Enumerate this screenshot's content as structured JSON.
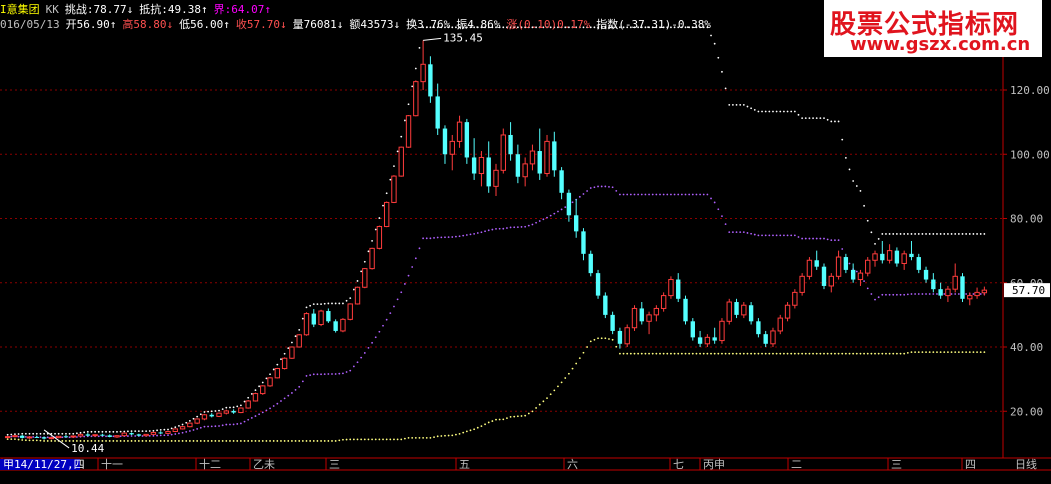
{
  "header": {
    "line1": [
      {
        "text": "I意集团",
        "color": "#ffff00"
      },
      {
        "text": "KK",
        "color": "#c0c0c0"
      },
      {
        "text": "挑战:78.77↓",
        "color": "#ffffff"
      },
      {
        "text": "抵抗:49.38↑",
        "color": "#ffffff"
      },
      {
        "text": "界:64.07↑",
        "color": "#ff00ff"
      }
    ],
    "line2": [
      {
        "text": "016/05/13",
        "color": "#c0c0c0"
      },
      {
        "text": "开56.90↑",
        "color": "#ffffff"
      },
      {
        "text": "高58.80↓",
        "color": "#ff5050"
      },
      {
        "text": "低56.00↑",
        "color": "#ffffff"
      },
      {
        "text": "收57.70↓",
        "color": "#ff5050"
      },
      {
        "text": "量76081↓",
        "color": "#ffffff"
      },
      {
        "text": "额43573↓",
        "color": "#ffffff"
      },
      {
        "text": "换3.76%",
        "color": "#ffffff"
      },
      {
        "text": "振4.86%",
        "color": "#ffffff"
      },
      {
        "text": "涨(0.10)0.17%",
        "color": "#ff5050"
      },
      {
        "text": "指数(-37.31)-0.38%",
        "color": "#ffffff"
      }
    ]
  },
  "watermark": {
    "title": "股票公式指标网",
    "url": "www.gszx.com.cn"
  },
  "colors": {
    "up": "#ff3c3c",
    "down": "#54ffff",
    "grid": "#8b0000",
    "axis": "#c00000",
    "upper": "#ffffff",
    "lower": "#ffff80",
    "mid": "#b060ff",
    "text": "#c0c0c0"
  },
  "chart_data": {
    "type": "candlestick",
    "ylim": [
      10,
      135
    ],
    "y_ticks": [
      "20.00",
      "40.00",
      "60.00",
      "80.00",
      "100.00",
      "120.00"
    ],
    "y_tick_values": [
      20,
      40,
      60,
      80,
      100,
      120
    ],
    "current_price": "57.70",
    "current_value": 57.7,
    "high_marker": "135.45",
    "high_value": 135.45,
    "low_marker": "10.44",
    "low_value": 10.44,
    "x_labels": [
      "甲14/11/27,四",
      "十一",
      "十二",
      "乙未",
      "三",
      "五",
      "六",
      "七",
      "丙申",
      "二",
      "三",
      "四",
      "日线"
    ],
    "candles": [
      [
        12,
        12.3,
        11.8,
        12.1
      ],
      [
        12.1,
        12.5,
        11.9,
        12.4
      ],
      [
        12.4,
        12.6,
        11.5,
        11.7
      ],
      [
        11.7,
        12.2,
        11.4,
        12.0
      ],
      [
        12.0,
        12.4,
        11.7,
        11.9
      ],
      [
        11.9,
        12.1,
        11.2,
        11.5
      ],
      [
        11.5,
        12.0,
        11.2,
        11.8
      ],
      [
        11.8,
        12.3,
        11.6,
        12.2
      ],
      [
        12.2,
        12.6,
        11.9,
        12.0
      ],
      [
        12.0,
        12.4,
        11.7,
        12.3
      ],
      [
        12.3,
        12.9,
        12.1,
        12.8
      ],
      [
        12.8,
        13.2,
        12.2,
        12.4
      ],
      [
        12.4,
        12.8,
        12.0,
        12.7
      ],
      [
        12.7,
        13.0,
        12.3,
        12.5
      ],
      [
        12.5,
        12.8,
        11.9,
        12.0
      ],
      [
        12.0,
        12.5,
        11.7,
        12.4
      ],
      [
        12.4,
        13.3,
        12.3,
        13.2
      ],
      [
        13.2,
        13.4,
        12.6,
        12.8
      ],
      [
        12.8,
        13.0,
        12.2,
        12.4
      ],
      [
        12.4,
        12.9,
        12.2,
        12.8
      ],
      [
        12.8,
        13.5,
        12.7,
        13.4
      ],
      [
        13.4,
        13.8,
        12.9,
        13.1
      ],
      [
        13.1,
        13.9,
        13.0,
        13.7
      ],
      [
        13.7,
        14.6,
        13.5,
        14.5
      ],
      [
        14.5,
        15.4,
        14.3,
        15.2
      ],
      [
        15.2,
        16.5,
        15.0,
        16.3
      ],
      [
        16.3,
        17.8,
        16.0,
        17.6
      ],
      [
        17.6,
        19.2,
        17.2,
        18.9
      ],
      [
        18.9,
        19.4,
        18.1,
        18.4
      ],
      [
        18.4,
        19.6,
        18.2,
        19.4
      ],
      [
        19.4,
        20.5,
        19.0,
        20.1
      ],
      [
        20.1,
        20.6,
        19.2,
        19.6
      ],
      [
        19.6,
        21.2,
        19.4,
        21.0
      ],
      [
        21.0,
        23.5,
        20.8,
        23.2
      ],
      [
        23.2,
        25.8,
        23.0,
        25.5
      ],
      [
        25.5,
        28.1,
        25.1,
        27.9
      ],
      [
        27.9,
        30.6,
        27.6,
        30.4
      ],
      [
        30.4,
        33.5,
        30.2,
        33.3
      ],
      [
        33.3,
        36.8,
        33.0,
        36.5
      ],
      [
        36.5,
        40.2,
        36.3,
        40.0
      ],
      [
        40.0,
        44.0,
        39.8,
        43.8
      ],
      [
        43.8,
        50.8,
        43.5,
        50.4
      ],
      [
        50.4,
        51.8,
        46.2,
        47.0
      ],
      [
        47.0,
        51.6,
        46.5,
        51.2
      ],
      [
        51.2,
        52.0,
        47.5,
        48.0
      ],
      [
        48.0,
        48.6,
        44.5,
        45.0
      ],
      [
        45.0,
        49.0,
        44.6,
        48.6
      ],
      [
        48.6,
        53.6,
        48.3,
        53.4
      ],
      [
        53.4,
        58.8,
        53.2,
        58.6
      ],
      [
        58.6,
        64.6,
        58.3,
        64.4
      ],
      [
        64.4,
        70.9,
        64.1,
        70.7
      ],
      [
        70.7,
        77.8,
        70.4,
        77.5
      ],
      [
        77.5,
        85.3,
        77.3,
        85.0
      ],
      [
        85.0,
        93.5,
        84.8,
        93.2
      ],
      [
        93.2,
        102.4,
        93.0,
        102.2
      ],
      [
        102.2,
        112.2,
        102.0,
        112.0
      ],
      [
        112.0,
        123.0,
        111.8,
        122.6
      ],
      [
        122.6,
        135.45,
        120.0,
        128.0
      ],
      [
        128.0,
        130.5,
        116.0,
        118.0
      ],
      [
        118.0,
        122.0,
        106.0,
        108.0
      ],
      [
        108.0,
        109.0,
        97.0,
        100.0
      ],
      [
        100.0,
        106.0,
        95.0,
        104.0
      ],
      [
        104.0,
        112.0,
        102.0,
        110.0
      ],
      [
        110.0,
        111.0,
        97.0,
        99.0
      ],
      [
        99.0,
        105.0,
        92.0,
        94.0
      ],
      [
        94.0,
        101.0,
        90.0,
        99.0
      ],
      [
        99.0,
        104.0,
        88.0,
        90.0
      ],
      [
        90.0,
        97.0,
        87.0,
        95.0
      ],
      [
        95.0,
        108.0,
        94.0,
        106.0
      ],
      [
        106.0,
        110.0,
        98.0,
        100.0
      ],
      [
        100.0,
        103.0,
        91.0,
        93.0
      ],
      [
        93.0,
        99.0,
        90.0,
        97.0
      ],
      [
        97.0,
        103.0,
        95.0,
        101.0
      ],
      [
        101.0,
        108.0,
        92.0,
        94.0
      ],
      [
        94.0,
        106.0,
        93.0,
        104.0
      ],
      [
        104.0,
        107.0,
        93.0,
        95.0
      ],
      [
        95.0,
        96.0,
        86.0,
        88.0
      ],
      [
        88.0,
        89.0,
        79.0,
        81.0
      ],
      [
        81.0,
        86.0,
        74.0,
        76.0
      ],
      [
        76.0,
        77.0,
        67.0,
        69.0
      ],
      [
        69.0,
        70.0,
        62.0,
        63.0
      ],
      [
        63.0,
        64.0,
        55.0,
        56.0
      ],
      [
        56.0,
        57.0,
        49.0,
        50.0
      ],
      [
        50.0,
        51.0,
        44.0,
        45.0
      ],
      [
        45.0,
        46.0,
        39.5,
        41.0
      ],
      [
        41.0,
        47.0,
        40.0,
        46.0
      ],
      [
        46.0,
        53.0,
        45.0,
        52.0
      ],
      [
        52.0,
        54.0,
        47.0,
        48.0
      ],
      [
        48.0,
        51.0,
        44.0,
        50.0
      ],
      [
        50.0,
        53.0,
        48.0,
        52.0
      ],
      [
        52.0,
        57.0,
        51.0,
        56.0
      ],
      [
        56.0,
        62.0,
        55.0,
        61.0
      ],
      [
        61.0,
        63.0,
        54.0,
        55.0
      ],
      [
        55.0,
        56.0,
        47.0,
        48.0
      ],
      [
        48.0,
        49.0,
        42.0,
        43.0
      ],
      [
        43.0,
        45.0,
        40.0,
        41.0
      ],
      [
        41.0,
        44.0,
        40.0,
        43.0
      ],
      [
        43.0,
        46.0,
        41.0,
        42.0
      ],
      [
        42.0,
        49.0,
        41.0,
        48.0
      ],
      [
        48.0,
        55.0,
        47.0,
        54.0
      ],
      [
        54.0,
        55.0,
        49.0,
        50.0
      ],
      [
        50.0,
        54.0,
        49.0,
        53.0
      ],
      [
        53.0,
        54.0,
        47.0,
        48.0
      ],
      [
        48.0,
        49.0,
        43.0,
        44.0
      ],
      [
        44.0,
        45.0,
        40.0,
        41.0
      ],
      [
        41.0,
        46.0,
        40.0,
        45.0
      ],
      [
        45.0,
        50.0,
        44.0,
        49.0
      ],
      [
        49.0,
        54.0,
        48.0,
        53.0
      ],
      [
        53.0,
        58.0,
        52.0,
        57.0
      ],
      [
        57.0,
        63.0,
        56.0,
        62.0
      ],
      [
        62.0,
        68.0,
        61.0,
        67.0
      ],
      [
        67.0,
        70.0,
        64.0,
        65.0
      ],
      [
        65.0,
        66.0,
        58.0,
        59.0
      ],
      [
        59.0,
        63.0,
        57.0,
        62.0
      ],
      [
        62.0,
        70.0,
        61.0,
        68.0
      ],
      [
        68.0,
        69.0,
        63.0,
        64.0
      ],
      [
        64.0,
        66.0,
        60.0,
        61.0
      ],
      [
        61.0,
        64.0,
        59.0,
        63.0
      ],
      [
        63.0,
        68.0,
        62.0,
        67.0
      ],
      [
        67.0,
        70.0,
        65.0,
        69.0
      ],
      [
        69.0,
        73.0,
        66.0,
        67.0
      ],
      [
        67.0,
        72.0,
        66.0,
        70.0
      ],
      [
        70.0,
        71.0,
        65.0,
        66.0
      ],
      [
        66.0,
        70.0,
        64.0,
        69.0
      ],
      [
        69.0,
        73.0,
        67.0,
        68.0
      ],
      [
        68.0,
        69.0,
        63.0,
        64.0
      ],
      [
        64.0,
        65.0,
        60.0,
        61.0
      ],
      [
        61.0,
        63.0,
        57.0,
        58.0
      ],
      [
        58.0,
        60.0,
        55.0,
        56.0
      ],
      [
        56.0,
        59.0,
        54.0,
        58.0
      ],
      [
        58.0,
        66.0,
        57.0,
        62.0
      ],
      [
        62.0,
        63.0,
        54.0,
        55.0
      ],
      [
        55.0,
        57.0,
        53.0,
        56.0
      ],
      [
        56.0,
        58.5,
        55.0,
        57.0
      ],
      [
        56.9,
        58.8,
        56.0,
        57.7
      ]
    ]
  }
}
